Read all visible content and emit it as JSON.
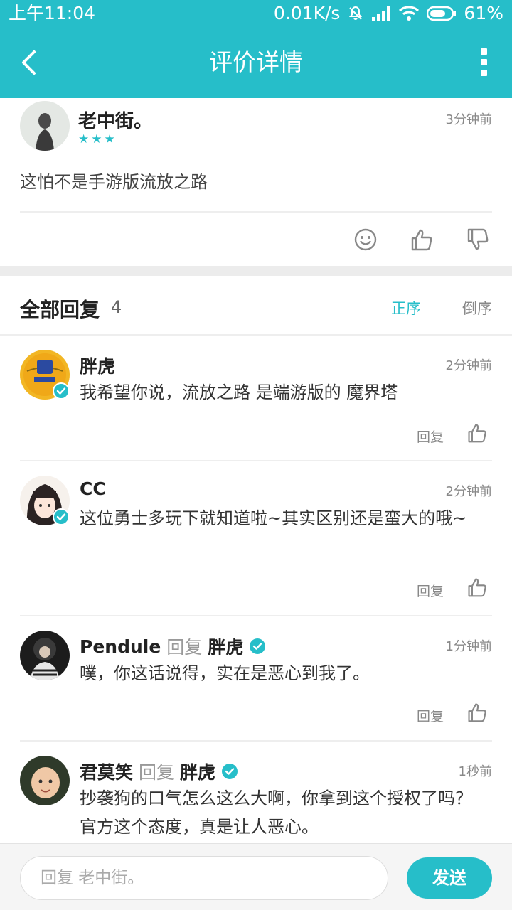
{
  "status_bar": {
    "time": "上午11:04",
    "speed": "0.01K/s",
    "battery": "61%",
    "icons": [
      "mute-bell-icon",
      "signal-icon",
      "wifi-icon",
      "battery-icon"
    ]
  },
  "app_bar": {
    "title": "评价详情",
    "back_icon": "chevron-left-icon",
    "more_icon": "vertical-dots-icon"
  },
  "review": {
    "user": "老中街。",
    "rating_stars": "★★★",
    "time": "3分钟前",
    "text": "这怕不是手游版流放之路",
    "actions": [
      "smiley-icon",
      "thumbs-up-icon",
      "thumbs-down-icon"
    ]
  },
  "replies_header": {
    "title": "全部回复",
    "count": "4",
    "sort_asc": "正序",
    "sort_desc": "倒序"
  },
  "replies": [
    {
      "user": "胖虎",
      "time": "2分钟前",
      "text": "我希望你说，流放之路 是端游版的 魔界塔",
      "verified": true,
      "reply_label": "回复"
    },
    {
      "user": "CC",
      "time": "2分钟前",
      "text": "这位勇士多玩下就知道啦~其实区别还是蛮大的哦~",
      "verified": true,
      "reply_label": "回复"
    },
    {
      "user": "Pendule",
      "reply_word": "回复",
      "reply_to": "胖虎",
      "time": "1分钟前",
      "text": "噗，你这话说得，实在是恶心到我了。",
      "reply_label": "回复"
    },
    {
      "user": "君莫笑",
      "reply_word": "回复",
      "reply_to": "胖虎",
      "time": "1秒前",
      "text": "抄袭狗的口气怎么这么大啊，你拿到这个授权了吗？官方这个态度，真是让人恶心。"
    }
  ],
  "compose": {
    "placeholder": "回复 老中街。",
    "send_label": "发送"
  },
  "colors": {
    "accent": "#26bec9",
    "divider": "#eeeeee"
  }
}
